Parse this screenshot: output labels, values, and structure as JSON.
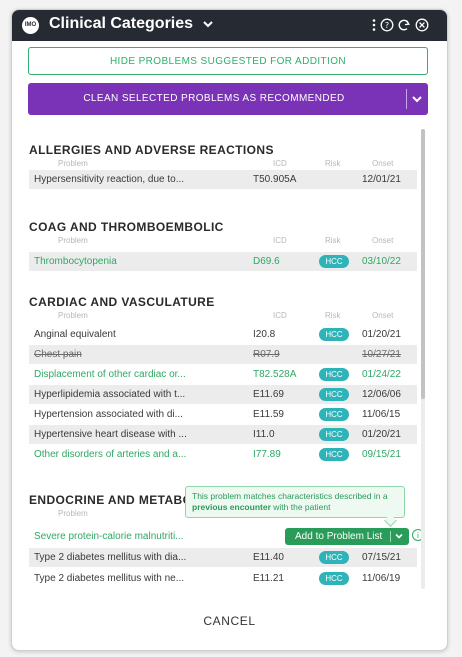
{
  "header": {
    "logo_text": "IMO",
    "title": "Clinical Categories",
    "icons": [
      "kebab-menu-icon",
      "help-icon",
      "refresh-icon",
      "close-icon"
    ]
  },
  "actions": {
    "hide_label": "HIDE PROBLEMS SUGGESTED FOR ADDITION",
    "clean_label": "CLEAN SELECTED PROBLEMS AS RECOMMENDED"
  },
  "columns": {
    "problem": "Problem",
    "icd": "ICD",
    "risk": "Risk",
    "onset": "Onset"
  },
  "sections": [
    {
      "title": "ALLERGIES AND ADVERSE REACTIONS",
      "rows": [
        {
          "name": "Hypersensitivity reaction, due to...",
          "icd": "T50.905A",
          "risk": "",
          "onset": "12/01/21",
          "state": "normal"
        }
      ]
    },
    {
      "title": "COAG AND THROMBOEMBOLIC",
      "rows": [
        {
          "name": "Thrombocytopenia",
          "icd": "D69.6",
          "risk": "HCC",
          "onset": "03/10/22",
          "state": "suggested"
        }
      ]
    },
    {
      "title": "CARDIAC AND VASCULATURE",
      "rows": [
        {
          "name": "Anginal equivalent",
          "icd": "I20.8",
          "risk": "HCC",
          "onset": "01/20/21",
          "state": "normal"
        },
        {
          "name": "Chest pain",
          "icd": "R07.9",
          "risk": "",
          "onset": "10/27/21",
          "state": "removed"
        },
        {
          "name": "Displacement of other cardiac or...",
          "icd": "T82.528A",
          "risk": "HCC",
          "onset": "01/24/22",
          "state": "suggested"
        },
        {
          "name": "Hyperlipidemia associated with t...",
          "icd": "E11.69",
          "risk": "HCC",
          "onset": "12/06/06",
          "state": "normal"
        },
        {
          "name": "Hypertension associated with di...",
          "icd": "E11.59",
          "risk": "HCC",
          "onset": "11/06/15",
          "state": "normal"
        },
        {
          "name": "Hypertensive heart disease with ...",
          "icd": "I11.0",
          "risk": "HCC",
          "onset": "01/20/21",
          "state": "normal"
        },
        {
          "name": "Other disorders of arteries and a...",
          "icd": "I77.89",
          "risk": "HCC",
          "onset": "09/15/21",
          "state": "suggested"
        }
      ]
    },
    {
      "title": "ENDOCRINE AND METABO",
      "rows": [
        {
          "name": "Severe protein-calorie malnutriti...",
          "icd": "",
          "risk": "",
          "onset": "",
          "state": "suggested",
          "action": "Add to Problem List"
        },
        {
          "name": "Type 2 diabetes mellitus with dia...",
          "icd": "E11.40",
          "risk": "HCC",
          "onset": "07/15/21",
          "state": "normal"
        },
        {
          "name": "Type 2 diabetes mellitus with ne...",
          "icd": "E11.21",
          "risk": "HCC",
          "onset": "11/06/19",
          "state": "normal"
        }
      ]
    }
  ],
  "tooltip": {
    "text_a": "This problem matches characteristics described in a ",
    "text_bold": "previous encounter",
    "text_b": " with the patient"
  },
  "footer": {
    "cancel_label": "CANCEL"
  },
  "colors": {
    "titlebar": "#262b33",
    "accent_purple": "#7a33b7",
    "suggested_green": "#2fa864",
    "hcc_teal": "#2eb3b8"
  }
}
